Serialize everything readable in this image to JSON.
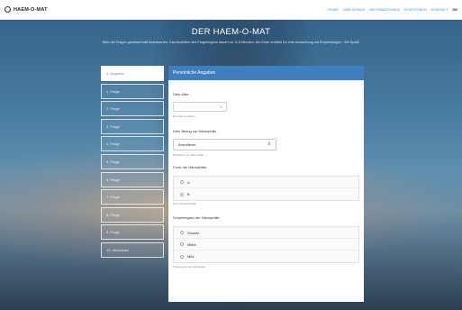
{
  "header": {
    "brand": "HAEM-O-MAT",
    "nav": [
      "HOME",
      "UND SOWAS",
      "INFORMATIONEN",
      "STATISTIKEN",
      "KONTAKT"
    ],
    "language": "DE"
  },
  "hero": {
    "title": "DER HAEM-O-MAT",
    "subtitle": "Bitte die Fragen gewissenhaft beantworten. Das Ausfüllen des Fragebogens dauert ca. 3–5 Minuten. Am Ende erhältst Du eine Auswertung mit Empfehlungen. Viel Spaß!"
  },
  "sidebar": {
    "steps": [
      "1. Angaben",
      "1. Frage",
      "2. Frage",
      "3. Frage",
      "4. Frage",
      "5. Frage",
      "6. Frage",
      "7. Frage",
      "8. Frage",
      "9. Frage",
      "10. Abschluss"
    ],
    "active_index": 0
  },
  "form": {
    "heading": "Persönliche Angaben",
    "age": {
      "label": "Dein Alter",
      "value": "",
      "help": "Dein Alter in Jahren"
    },
    "relation": {
      "label": "Dein Bezug zur Hämophilie",
      "value": "Betroffener",
      "help": "Dein Bezug zur Hämophilie"
    },
    "form_type": {
      "label": "Form der Hämophilie",
      "options": [
        "A",
        "B"
      ],
      "help": "Form der Hämophilie"
    },
    "severity": {
      "label": "Schweregrad der Hämophilie",
      "options": [
        "Schwer",
        "Mittel",
        "Mild"
      ],
      "help": "Schweregrad der Hämophilie"
    }
  }
}
